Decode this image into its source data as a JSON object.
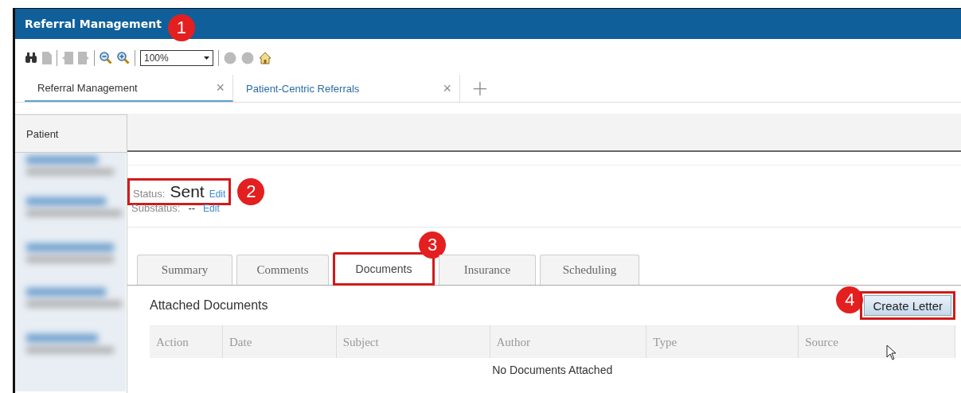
{
  "window": {
    "title": "Referral Management",
    "callout": "1"
  },
  "toolbar": {
    "zoom": "100%"
  },
  "tabs": [
    {
      "label": "Referral Management",
      "selected": true,
      "close": "×"
    },
    {
      "label": "Patient-Centric Referrals",
      "selected": false,
      "close": "×"
    }
  ],
  "new_tab": "+",
  "sidebar": {
    "header": "Patient"
  },
  "status": {
    "label": "Status:",
    "value": "Sent",
    "edit": "Edit",
    "highlighted": true,
    "callout": "2"
  },
  "substatus": {
    "label": "Substatus:",
    "value": "--",
    "edit": "Edit"
  },
  "detail_tabs": [
    {
      "label": "Summary",
      "selected": false,
      "highlighted": false
    },
    {
      "label": "Comments",
      "selected": false,
      "highlighted": false
    },
    {
      "label": "Documents",
      "selected": true,
      "highlighted": true,
      "callout": "3"
    },
    {
      "label": "Insurance",
      "selected": false,
      "highlighted": false
    },
    {
      "label": "Scheduling",
      "selected": false,
      "highlighted": false
    }
  ],
  "documents": {
    "title": "Attached Documents",
    "columns": [
      "Action",
      "Date",
      "Subject",
      "Author",
      "Type",
      "Source"
    ],
    "empty": "No Documents Attached"
  },
  "create_button": {
    "label": "Create Letter",
    "highlighted": true,
    "callout": "4"
  }
}
